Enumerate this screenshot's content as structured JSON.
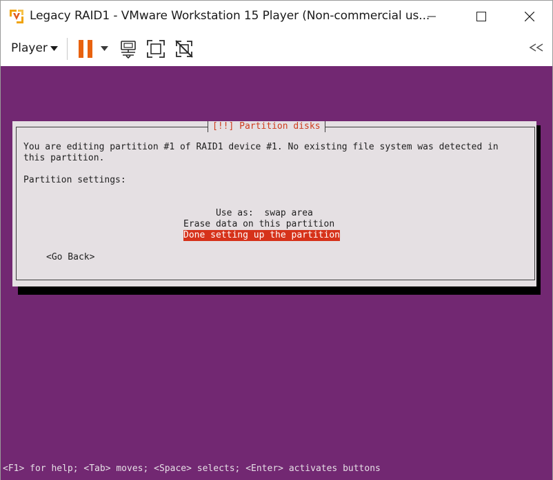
{
  "window": {
    "title": "Legacy RAID1 - VMware Workstation 15 Player (Non-commercial us...",
    "minimize_icon": "minimize-icon",
    "maximize_icon": "maximize-icon",
    "close_icon": "close-icon",
    "app_icon": "vmware-logo-icon"
  },
  "toolbar": {
    "player_label": "Player",
    "icons": [
      "pause-icon",
      "send-ctrl-alt-del-icon",
      "fullscreen-icon",
      "unity-icon",
      "collapse-toolbar-icon"
    ],
    "accent_color": "#e8620f"
  },
  "installer": {
    "background_color": "#722872",
    "dialog_title": "[!!] Partition disks",
    "intro_line1": "You are editing partition #1 of RAID1 device #1. No existing file system was detected in",
    "intro_line2": "this partition.",
    "settings_heading": "Partition settings:",
    "use_as_label": "Use as:",
    "use_as_value": "swap area",
    "erase_option": "Erase data on this partition",
    "done_option": "Done setting up the partition",
    "go_back": "<Go Back>",
    "status_help": "<F1> for help; <Tab> moves; <Space> selects; <Enter> activates buttons",
    "highlight_color": "#d6321a"
  }
}
